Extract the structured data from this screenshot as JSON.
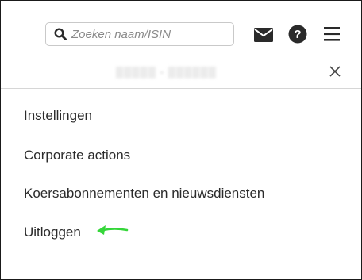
{
  "header": {
    "search": {
      "placeholder": "Zoeken naam/ISIN",
      "icon": "search-icon"
    },
    "icons": [
      "mail-icon",
      "help-icon",
      "hamburger-menu-icon"
    ]
  },
  "account": {
    "id_text": "▒▒▒▒▒ - ▒▒▒▒▒▒",
    "close_icon": "close-icon"
  },
  "menu": {
    "items": [
      {
        "label": "Instellingen"
      },
      {
        "label": "Corporate actions"
      },
      {
        "label": "Koersabonnementen en nieuwsdiensten"
      },
      {
        "label": "Uitloggen"
      }
    ]
  },
  "colors": {
    "accent_arrow": "#35d63a",
    "icon_dark": "#2a2a2a",
    "divider": "#d6d6d6"
  }
}
